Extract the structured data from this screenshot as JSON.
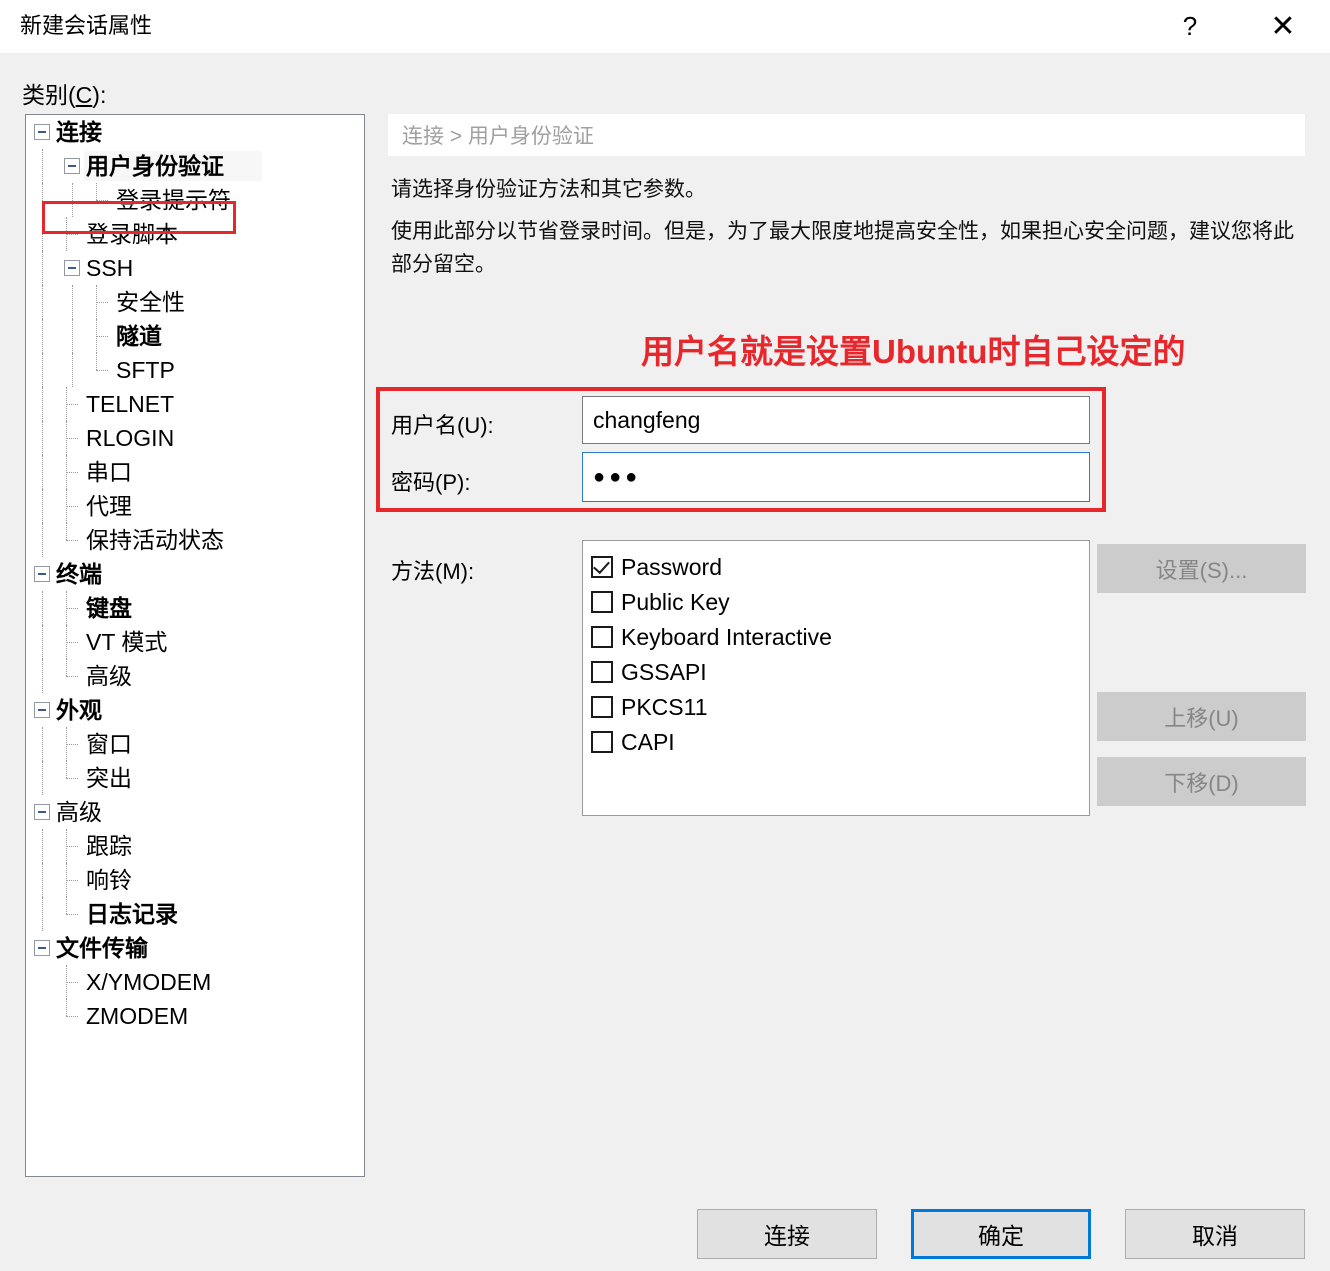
{
  "window": {
    "title": "新建会话属性",
    "help_icon": "question-mark-icon",
    "close_icon": "close-icon",
    "help_label": "?",
    "close_label": "✕"
  },
  "category": {
    "label_prefix": "类别(",
    "label_key": "C",
    "label_suffix": "):"
  },
  "tree": {
    "items": [
      {
        "label": "连接",
        "depth": 0,
        "bold": true,
        "toggle": "minus",
        "selected": false
      },
      {
        "label": "用户身份验证",
        "depth": 1,
        "bold": true,
        "toggle": "minus",
        "selected": true
      },
      {
        "label": "登录提示符",
        "depth": 2,
        "bold": false,
        "toggle": "none",
        "selected": false
      },
      {
        "label": "登录脚本",
        "depth": 1,
        "bold": false,
        "toggle": "none",
        "selected": false
      },
      {
        "label": "SSH",
        "depth": 1,
        "bold": false,
        "toggle": "minus",
        "selected": false
      },
      {
        "label": "安全性",
        "depth": 2,
        "bold": false,
        "toggle": "none",
        "selected": false
      },
      {
        "label": "隧道",
        "depth": 2,
        "bold": true,
        "toggle": "none",
        "selected": false
      },
      {
        "label": "SFTP",
        "depth": 2,
        "bold": false,
        "toggle": "none",
        "selected": false
      },
      {
        "label": "TELNET",
        "depth": 1,
        "bold": false,
        "toggle": "none",
        "selected": false
      },
      {
        "label": "RLOGIN",
        "depth": 1,
        "bold": false,
        "toggle": "none",
        "selected": false
      },
      {
        "label": "串口",
        "depth": 1,
        "bold": false,
        "toggle": "none",
        "selected": false
      },
      {
        "label": "代理",
        "depth": 1,
        "bold": false,
        "toggle": "none",
        "selected": false
      },
      {
        "label": "保持活动状态",
        "depth": 1,
        "bold": false,
        "toggle": "none",
        "selected": false
      },
      {
        "label": "终端",
        "depth": 0,
        "bold": true,
        "toggle": "minus",
        "selected": false
      },
      {
        "label": "键盘",
        "depth": 1,
        "bold": true,
        "toggle": "none",
        "selected": false
      },
      {
        "label": "VT 模式",
        "depth": 1,
        "bold": false,
        "toggle": "none",
        "selected": false
      },
      {
        "label": "高级",
        "depth": 1,
        "bold": false,
        "toggle": "none",
        "selected": false
      },
      {
        "label": "外观",
        "depth": 0,
        "bold": true,
        "toggle": "minus",
        "selected": false
      },
      {
        "label": "窗口",
        "depth": 1,
        "bold": false,
        "toggle": "none",
        "selected": false
      },
      {
        "label": "突出",
        "depth": 1,
        "bold": false,
        "toggle": "none",
        "selected": false
      },
      {
        "label": "高级",
        "depth": 0,
        "bold": false,
        "toggle": "minus",
        "selected": false
      },
      {
        "label": "跟踪",
        "depth": 1,
        "bold": false,
        "toggle": "none",
        "selected": false
      },
      {
        "label": "响铃",
        "depth": 1,
        "bold": false,
        "toggle": "none",
        "selected": false
      },
      {
        "label": "日志记录",
        "depth": 1,
        "bold": true,
        "toggle": "none",
        "selected": false
      },
      {
        "label": "文件传输",
        "depth": 0,
        "bold": true,
        "toggle": "minus",
        "selected": false
      },
      {
        "label": "X/YMODEM",
        "depth": 1,
        "bold": false,
        "toggle": "none",
        "selected": false
      },
      {
        "label": "ZMODEM",
        "depth": 1,
        "bold": false,
        "toggle": "none",
        "selected": false
      }
    ]
  },
  "breadcrumb": {
    "text": "连接 > 用户身份验证"
  },
  "description": {
    "line1": "请选择身份验证方法和其它参数。",
    "line2": "使用此部分以节省登录时间。但是，为了最大限度地提高安全性，如果担心安全问题，建议您将此部分留空。"
  },
  "annotation": {
    "text": "用户名就是设置Ubuntu时自己设定的",
    "color": "#e8272c"
  },
  "credentials": {
    "username_label": "用户名(U):",
    "username_value": "changfeng",
    "password_label": "密码(P):",
    "password_value": "●●●",
    "focus_color": "#2a7cc7",
    "highlight_color": "#e8272c"
  },
  "methods": {
    "label": "方法(M):",
    "items": [
      {
        "label": "Password",
        "checked": true
      },
      {
        "label": "Public Key",
        "checked": false
      },
      {
        "label": "Keyboard Interactive",
        "checked": false
      },
      {
        "label": "GSSAPI",
        "checked": false
      },
      {
        "label": "PKCS11",
        "checked": false
      },
      {
        "label": "CAPI",
        "checked": false
      }
    ]
  },
  "side_buttons": {
    "settings": "设置(S)...",
    "move_up": "上移(U)",
    "move_down": "下移(D)"
  },
  "bottom_buttons": {
    "connect": "连接",
    "ok": "确定",
    "cancel": "取消",
    "default_accent": "#0078d7"
  }
}
